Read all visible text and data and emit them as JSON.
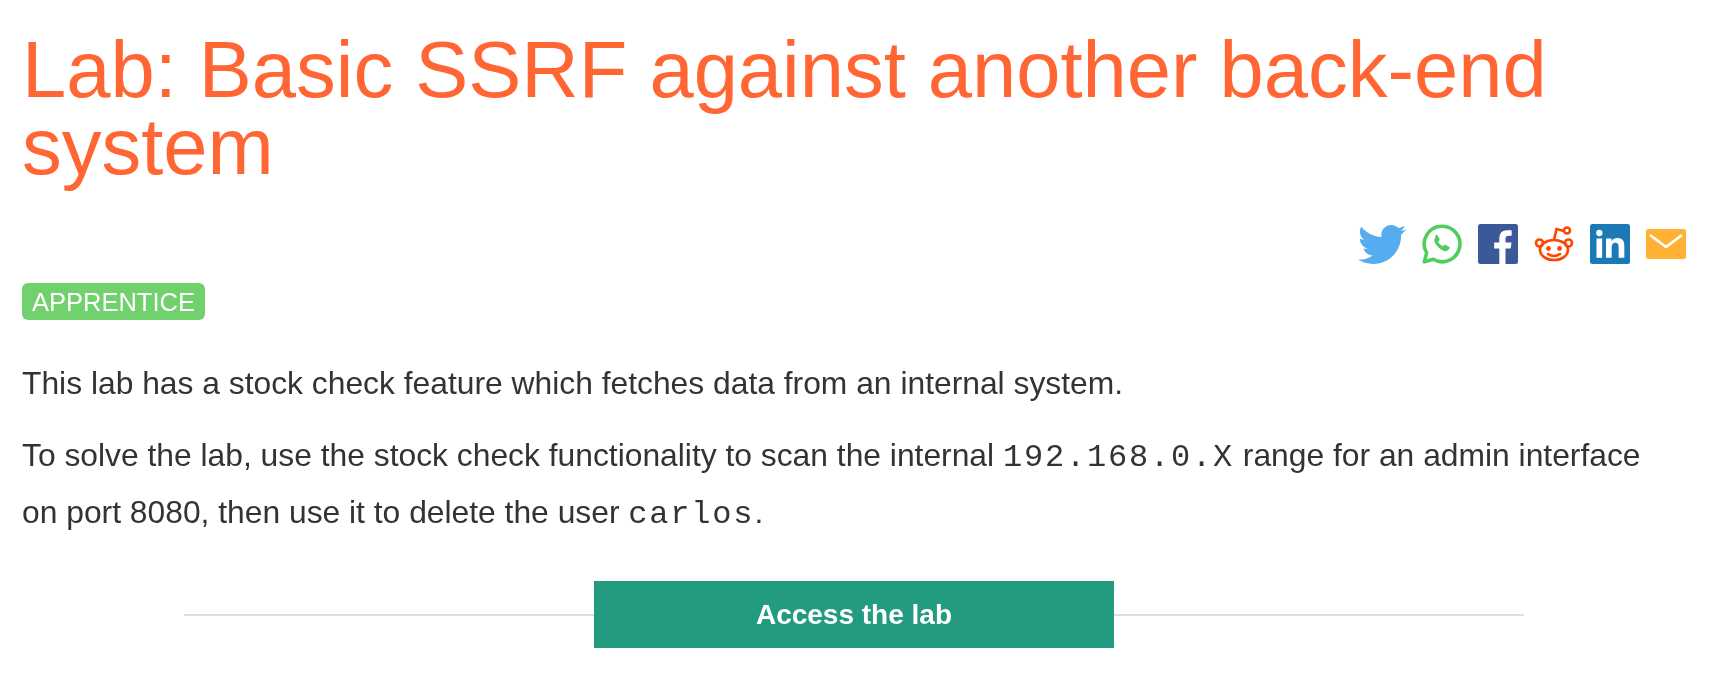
{
  "title": "Lab: Basic SSRF against another back-end system",
  "level_badge": "APPRENTICE",
  "paragraphs": [
    [
      {
        "kind": "text",
        "text": "This lab has a stock check feature which fetches data from an internal system."
      }
    ],
    [
      {
        "kind": "text",
        "text": "To solve the lab, use the stock check functionality to scan the internal "
      },
      {
        "kind": "code",
        "text": "192.168.0.X"
      },
      {
        "kind": "text",
        "text": " range for an admin interface on port 8080, then use it to delete the user "
      },
      {
        "kind": "code",
        "text": "carlos"
      },
      {
        "kind": "text",
        "text": "."
      }
    ]
  ],
  "button": "Access the lab"
}
